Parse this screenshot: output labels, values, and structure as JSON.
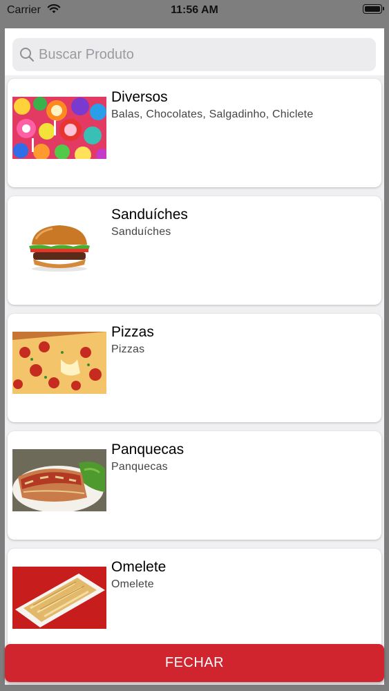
{
  "status_bar": {
    "carrier": "Carrier",
    "time": "11:56 AM"
  },
  "search": {
    "placeholder": "Buscar Produto"
  },
  "categories": [
    {
      "title": "Diversos",
      "subtitle": "Balas, Chocolates, Salgadinho, Chiclete",
      "image": "candy-photo"
    },
    {
      "title": "Sanduíches",
      "subtitle": "Sanduíches",
      "image": "burger-photo"
    },
    {
      "title": "Pizzas",
      "subtitle": "Pizzas",
      "image": "pizza-photo"
    },
    {
      "title": "Panquecas",
      "subtitle": "Panquecas",
      "image": "pancake-photo"
    },
    {
      "title": "Omelete",
      "subtitle": "Omelete",
      "image": "omelette-photo"
    }
  ],
  "footer": {
    "close_label": "FECHAR"
  },
  "colors": {
    "close_button": "#d0242e",
    "backdrop": "#7e7e7e",
    "sheet_background": "#f0f0f2"
  }
}
